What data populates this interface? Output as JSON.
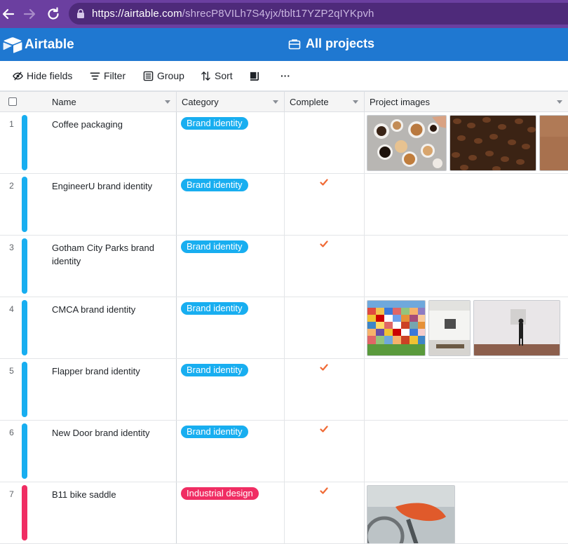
{
  "browser": {
    "url_host": "https://airtable.com",
    "url_path": "/shrecP8VILh7S4yjx/tblt17YZP2qIYKpvh"
  },
  "app": {
    "logo_text": "Airtable",
    "base_title": "All projects"
  },
  "toolbar": {
    "hide_fields": "Hide fields",
    "filter": "Filter",
    "group": "Group",
    "sort": "Sort",
    "more": "···"
  },
  "columns": {
    "name": "Name",
    "category": "Category",
    "complete": "Complete",
    "images": "Project images"
  },
  "colors": {
    "header_blue": "#1f78d1",
    "browser_purple": "#6b3fa0",
    "brand_identity": "#18aef0",
    "industrial_design": "#f02d63",
    "check_orange": "#f06a35"
  },
  "rows": [
    {
      "num": "1",
      "name": "Coffee packaging",
      "category": "Brand identity",
      "complete": false,
      "images": [
        "coffee-cups-photo",
        "coffee-beans-photo",
        "kraft-paper-photo"
      ]
    },
    {
      "num": "2",
      "name": "EngineerU brand identity",
      "category": "Brand identity",
      "complete": true,
      "images": []
    },
    {
      "num": "3",
      "name": "Gotham City Parks brand identity",
      "category": "Brand identity",
      "complete": true,
      "images": []
    },
    {
      "num": "4",
      "name": "CMCA brand identity",
      "category": "Brand identity",
      "complete": false,
      "images": [
        "colorful-facade-photo",
        "gallery-bench-photo",
        "gallery-visitor-photo"
      ]
    },
    {
      "num": "5",
      "name": "Flapper brand identity",
      "category": "Brand identity",
      "complete": true,
      "images": []
    },
    {
      "num": "6",
      "name": "New Door brand identity",
      "category": "Brand identity",
      "complete": true,
      "images": []
    },
    {
      "num": "7",
      "name": "B11 bike saddle",
      "category": "Industrial design",
      "complete": true,
      "images": [
        "bike-saddle-photo"
      ]
    }
  ]
}
